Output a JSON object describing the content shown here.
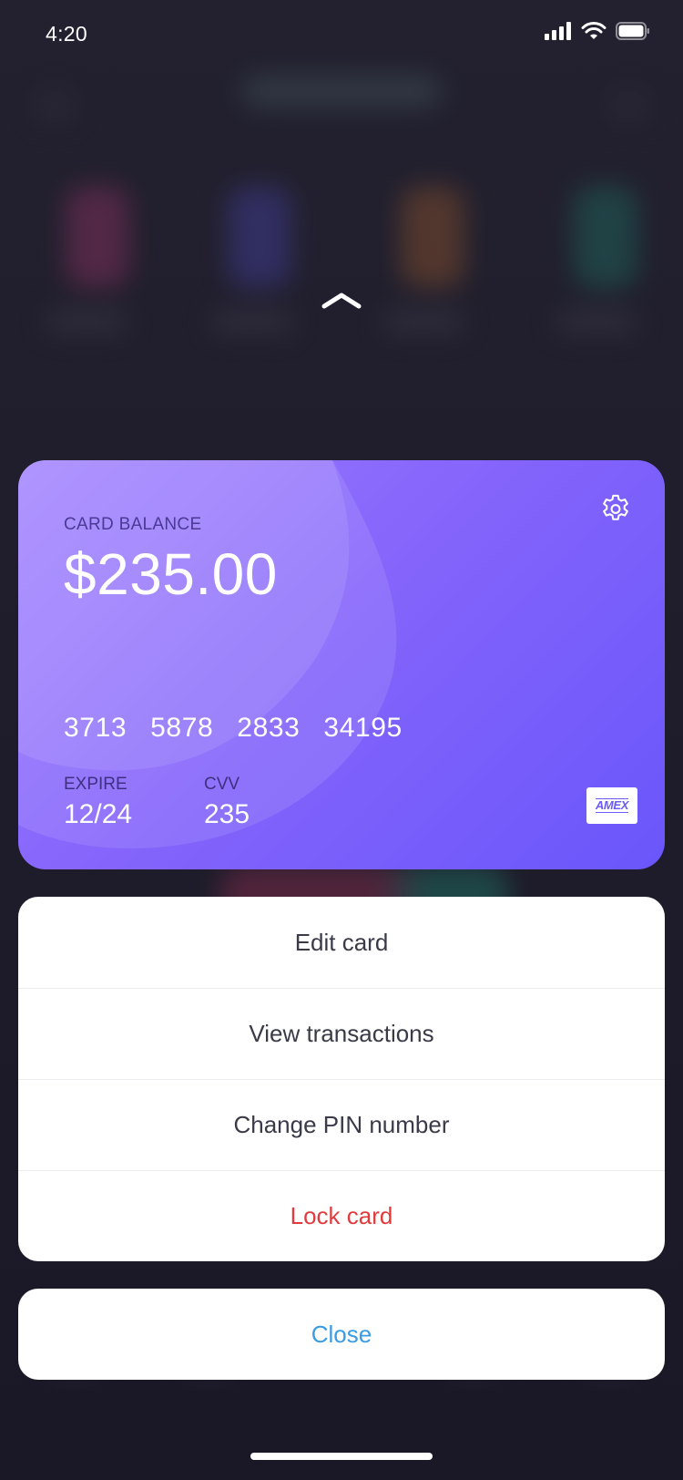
{
  "status_bar": {
    "time": "4:20"
  },
  "card": {
    "balance_label": "CARD BALANCE",
    "balance_amount": "$235.00",
    "number_groups": [
      "3713",
      "5878",
      "2833",
      "34195"
    ],
    "expire_label": "EXPIRE",
    "expire_value": "12/24",
    "cvv_label": "CVV",
    "cvv_value": "235",
    "brand_logo_text": "AMEX",
    "gradient_start": "#9d7cff",
    "gradient_end": "#6a56fb"
  },
  "actions": {
    "edit_card": "Edit card",
    "view_transactions": "View transactions",
    "change_pin": "Change PIN number",
    "lock_card": "Lock card"
  },
  "close_label": "Close",
  "colors": {
    "danger": "#e03a3e",
    "link": "#3b9be3"
  },
  "icons": {
    "settings": "gear-icon",
    "collapse": "chevron-up-icon"
  }
}
